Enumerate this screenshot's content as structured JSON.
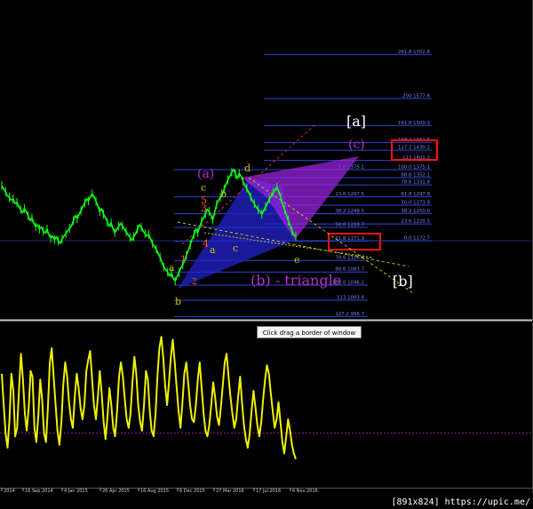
{
  "chart_data": {
    "type": "line",
    "title": "",
    "xlabel": "",
    "ylabel": "",
    "x_ticks": [
      "2014",
      "16 Sep 2014",
      "4 Jan 2015",
      "26 Apr 2015",
      "16 Aug 2015",
      "6 Dec 2015",
      "27 Mar 2016",
      "17 Jul 2016",
      "6 Nov 2016"
    ],
    "ylim": [
      930,
      1760
    ],
    "current_level": 1172.7,
    "series": [
      {
        "values": [
          1330,
          1320,
          1312,
          1300,
          1296,
          1288,
          1292,
          1279,
          1282,
          1270,
          1262,
          1252,
          1264,
          1256,
          1244,
          1230,
          1238,
          1222,
          1213,
          1218,
          1206,
          1212,
          1200,
          1195,
          1206,
          1190,
          1180,
          1186,
          1176,
          1184,
          1172,
          1165,
          1178,
          1186,
          1192,
          1201,
          1208,
          1215,
          1230,
          1244,
          1236,
          1248,
          1258,
          1270,
          1280,
          1292,
          1286,
          1298,
          1306,
          1298,
          1284,
          1272,
          1256,
          1264,
          1248,
          1238,
          1226,
          1214,
          1224,
          1207,
          1196,
          1204,
          1214,
          1222,
          1215,
          1206,
          1198,
          1190,
          1182,
          1174,
          1184,
          1192,
          1206,
          1218,
          1211,
          1200,
          1193,
          1186,
          1191,
          1178,
          1164,
          1156,
          1148,
          1136,
          1126,
          1110,
          1098,
          1090,
          1084,
          1072,
          1080,
          1066,
          1058,
          1070,
          1082,
          1096,
          1104,
          1116,
          1132,
          1146,
          1162,
          1178,
          1190,
          1206,
          1196,
          1212,
          1228,
          1238,
          1248,
          1262,
          1256,
          1246,
          1232,
          1256,
          1276,
          1288,
          1296,
          1304,
          1320,
          1334,
          1346,
          1356,
          1368,
          1376,
          1362,
          1350,
          1364,
          1356,
          1342,
          1330,
          1322,
          1310,
          1298,
          1286,
          1278,
          1268,
          1262,
          1256,
          1248,
          1258,
          1270,
          1280,
          1292,
          1300,
          1310,
          1318,
          1326,
          1312,
          1296,
          1278,
          1262,
          1246,
          1230,
          1214,
          1200,
          1190,
          1185
        ]
      },
      {
        "name": "oscillator",
        "values": [
          62,
          40,
          20,
          10,
          30,
          62,
          50,
          18,
          24,
          52,
          76,
          58,
          34,
          22,
          38,
          64,
          60,
          24,
          14,
          32,
          58,
          44,
          20,
          14,
          38,
          70,
          80,
          60,
          40,
          22,
          12,
          28,
          54,
          70,
          60,
          42,
          30,
          24,
          46,
          62,
          52,
          38,
          30,
          40,
          64,
          72,
          78,
          58,
          40,
          30,
          46,
          64,
          48,
          28,
          16,
          32,
          52,
          40,
          24,
          18,
          36,
          60,
          70,
          60,
          44,
          30,
          24,
          34,
          56,
          74,
          62,
          40,
          28,
          22,
          40,
          64,
          58,
          36,
          22,
          18,
          34,
          60,
          80,
          88,
          74,
          54,
          40,
          56,
          74,
          86,
          70,
          52,
          36,
          24,
          42,
          62,
          70,
          56,
          40,
          30,
          28,
          40,
          58,
          70,
          52,
          34,
          22,
          18,
          26,
          40,
          56,
          46,
          32,
          26,
          38,
          54,
          70,
          76,
          60,
          46,
          34,
          24,
          30,
          46,
          60,
          42,
          26,
          16,
          10,
          20,
          36,
          50,
          38,
          26,
          18,
          28,
          44,
          58,
          68,
          62,
          48,
          36,
          24,
          30,
          42,
          28,
          14,
          6,
          18,
          30,
          22,
          12,
          6,
          2
        ]
      }
    ],
    "fib_levels": [
      {
        "label": "261.8 1702.8",
        "price": 1702.8
      },
      {
        "label": "200 1577.6",
        "price": 1577.6
      },
      {
        "label": "161.8 1500.3",
        "price": 1500.3
      },
      {
        "label": "138.2 1452.5",
        "price": 1452.5
      },
      {
        "label": "127.2 1430.2",
        "price": 1430.2
      },
      {
        "label": "113 1401.3",
        "price": 1401.3
      },
      {
        "label": "100.0 1375.1",
        "price": 1375.1
      },
      {
        "label": "88.6 1352.1",
        "price": 1352.1
      },
      {
        "label": "78.6 1331.8",
        "price": 1331.8
      },
      {
        "label": "61.8 1297.8",
        "price": 1297.8
      },
      {
        "label": "50.0 1273.9",
        "price": 1273.9
      },
      {
        "label": "38.2 1250.0",
        "price": 1250.0
      },
      {
        "label": "23.6 1220.5",
        "price": 1220.5
      },
      {
        "label": "0.0 1172.7",
        "price": 1172.7
      }
    ],
    "retrace_levels": [
      {
        "label": "0.0 1375.1",
        "price": 1375.1
      },
      {
        "label": "23.6 1297.5",
        "price": 1297.5
      },
      {
        "label": "38.2 1249.5",
        "price": 1249.5
      },
      {
        "label": "50.0 1210.7",
        "price": 1210.7
      },
      {
        "label": "61.8 1171.9",
        "price": 1171.9
      },
      {
        "label": "78.6 1116.6",
        "price": 1116.6
      },
      {
        "label": "88.6 1083.7",
        "price": 1083.7
      },
      {
        "label": "100.0 1046.2",
        "price": 1046.2
      },
      {
        "label": "113 1003.4",
        "price": 1003.4
      },
      {
        "label": "127.2 956.7",
        "price": 956.7
      }
    ],
    "annotations": [
      {
        "text": "[a]",
        "color": "#ffffff"
      },
      {
        "text": "(c)",
        "color": "#b030d0"
      },
      {
        "text": "(a)",
        "color": "#b030d0"
      },
      {
        "text": "d",
        "color": "#c8c800"
      },
      {
        "text": "c",
        "color": "#c8c800"
      },
      {
        "text": "b",
        "color": "#c8c800"
      },
      {
        "text": "5",
        "color": "#ff5a1e"
      },
      {
        "text": "3",
        "color": "#ff5a1e"
      },
      {
        "text": "4",
        "color": "#ff5a1e"
      },
      {
        "text": "1",
        "color": "#ff5a1e"
      },
      {
        "text": "2",
        "color": "#ff5a1e"
      },
      {
        "text": "a",
        "color": "#c8c800"
      },
      {
        "text": "a",
        "color": "#c8c800"
      },
      {
        "text": "c",
        "color": "#c8c800"
      },
      {
        "text": "e",
        "color": "#c8c800"
      },
      {
        "text": "b",
        "color": "#c8c800"
      },
      {
        "text": "(b) - triangle",
        "color": "#b030d0"
      },
      {
        "text": "[b]",
        "color": "#ffffff"
      }
    ]
  },
  "tooltip": "Click  drag a border of window",
  "watermark": "[891x824] https://upic.me/"
}
